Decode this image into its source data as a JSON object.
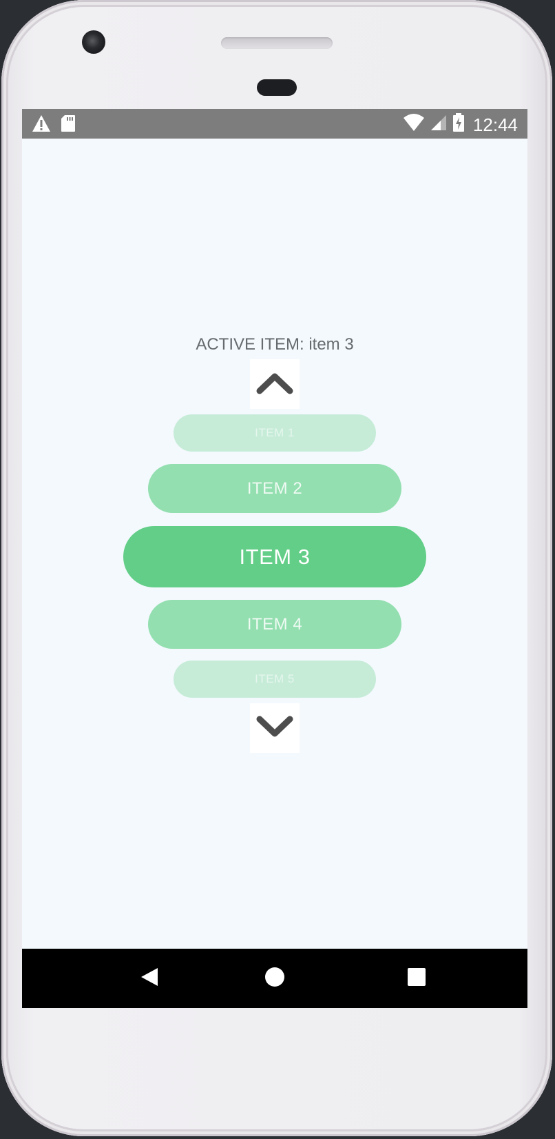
{
  "status_bar": {
    "time": "12:44",
    "left_icons": [
      "warning-icon",
      "sd-card-icon"
    ],
    "right_icons": [
      "wifi-icon",
      "signal-icon",
      "battery-charging-icon"
    ],
    "background_color": "#7d7d7d"
  },
  "main": {
    "active_label": "ACTIVE ITEM: item 3",
    "up_button_icon": "chevron-up-icon",
    "down_button_icon": "chevron-down-icon",
    "items": [
      {
        "label": "ITEM 1",
        "color": "#c6ecd8"
      },
      {
        "label": "ITEM 2",
        "color": "#93dfb0"
      },
      {
        "label": "ITEM 3",
        "color": "#62ce87"
      },
      {
        "label": "ITEM 4",
        "color": "#93dfb0"
      },
      {
        "label": "ITEM 5",
        "color": "#c6ecd8"
      }
    ],
    "active_index": 2,
    "background_color": "#f3f9fd"
  },
  "nav_bar": {
    "buttons": [
      "back-icon",
      "home-icon",
      "recents-icon"
    ]
  }
}
